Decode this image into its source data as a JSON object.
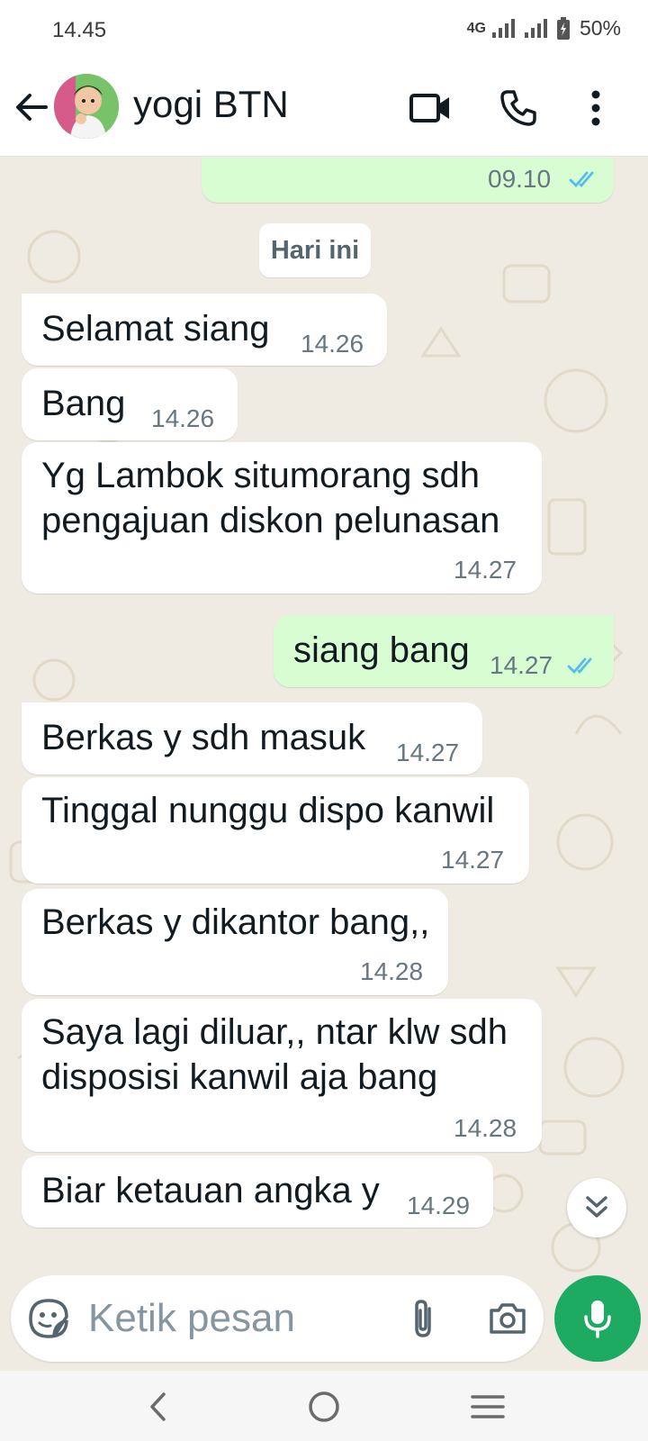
{
  "status_bar": {
    "time": "14.45",
    "network": "4G",
    "battery": "50%"
  },
  "header": {
    "contact_name": "yogi BTN",
    "icons": [
      "back-arrow-icon",
      "video-call-icon",
      "phone-icon",
      "more-options-icon"
    ]
  },
  "chat": {
    "date_divider": "Hari ini",
    "messages": [
      {
        "direction": "out",
        "text": "",
        "time": "09.10",
        "status": "read"
      },
      {
        "direction": "in",
        "text": "Selamat siang",
        "time": "14.26"
      },
      {
        "direction": "in",
        "text": "Bang",
        "time": "14.26"
      },
      {
        "direction": "in",
        "lines": [
          "Yg Lambok situmorang sdh",
          "pengajuan diskon pelunasan"
        ],
        "time": "14.27"
      },
      {
        "direction": "out",
        "text": "siang bang",
        "time": "14.27",
        "status": "read"
      },
      {
        "direction": "in",
        "text": "Berkas y sdh masuk",
        "time": "14.27"
      },
      {
        "direction": "in",
        "text": "Tinggal nunggu dispo kanwil",
        "time": "14.27"
      },
      {
        "direction": "in",
        "text": "Berkas y dikantor bang,,",
        "time": "14.28"
      },
      {
        "direction": "in",
        "lines": [
          "Saya lagi diluar,, ntar klw sdh",
          "disposisi kanwil aja bang"
        ],
        "time": "14.28"
      },
      {
        "direction": "in",
        "text": "Biar ketauan angka y",
        "time": "14.29"
      }
    ]
  },
  "composer": {
    "placeholder": "Ketik pesan"
  },
  "colors": {
    "incoming_bubble": "#ffffff",
    "outgoing_bubble": "#d9fdd3",
    "chat_background": "#efeae2",
    "accent_green": "#1daa61",
    "read_ticks": "#53bdeb"
  }
}
